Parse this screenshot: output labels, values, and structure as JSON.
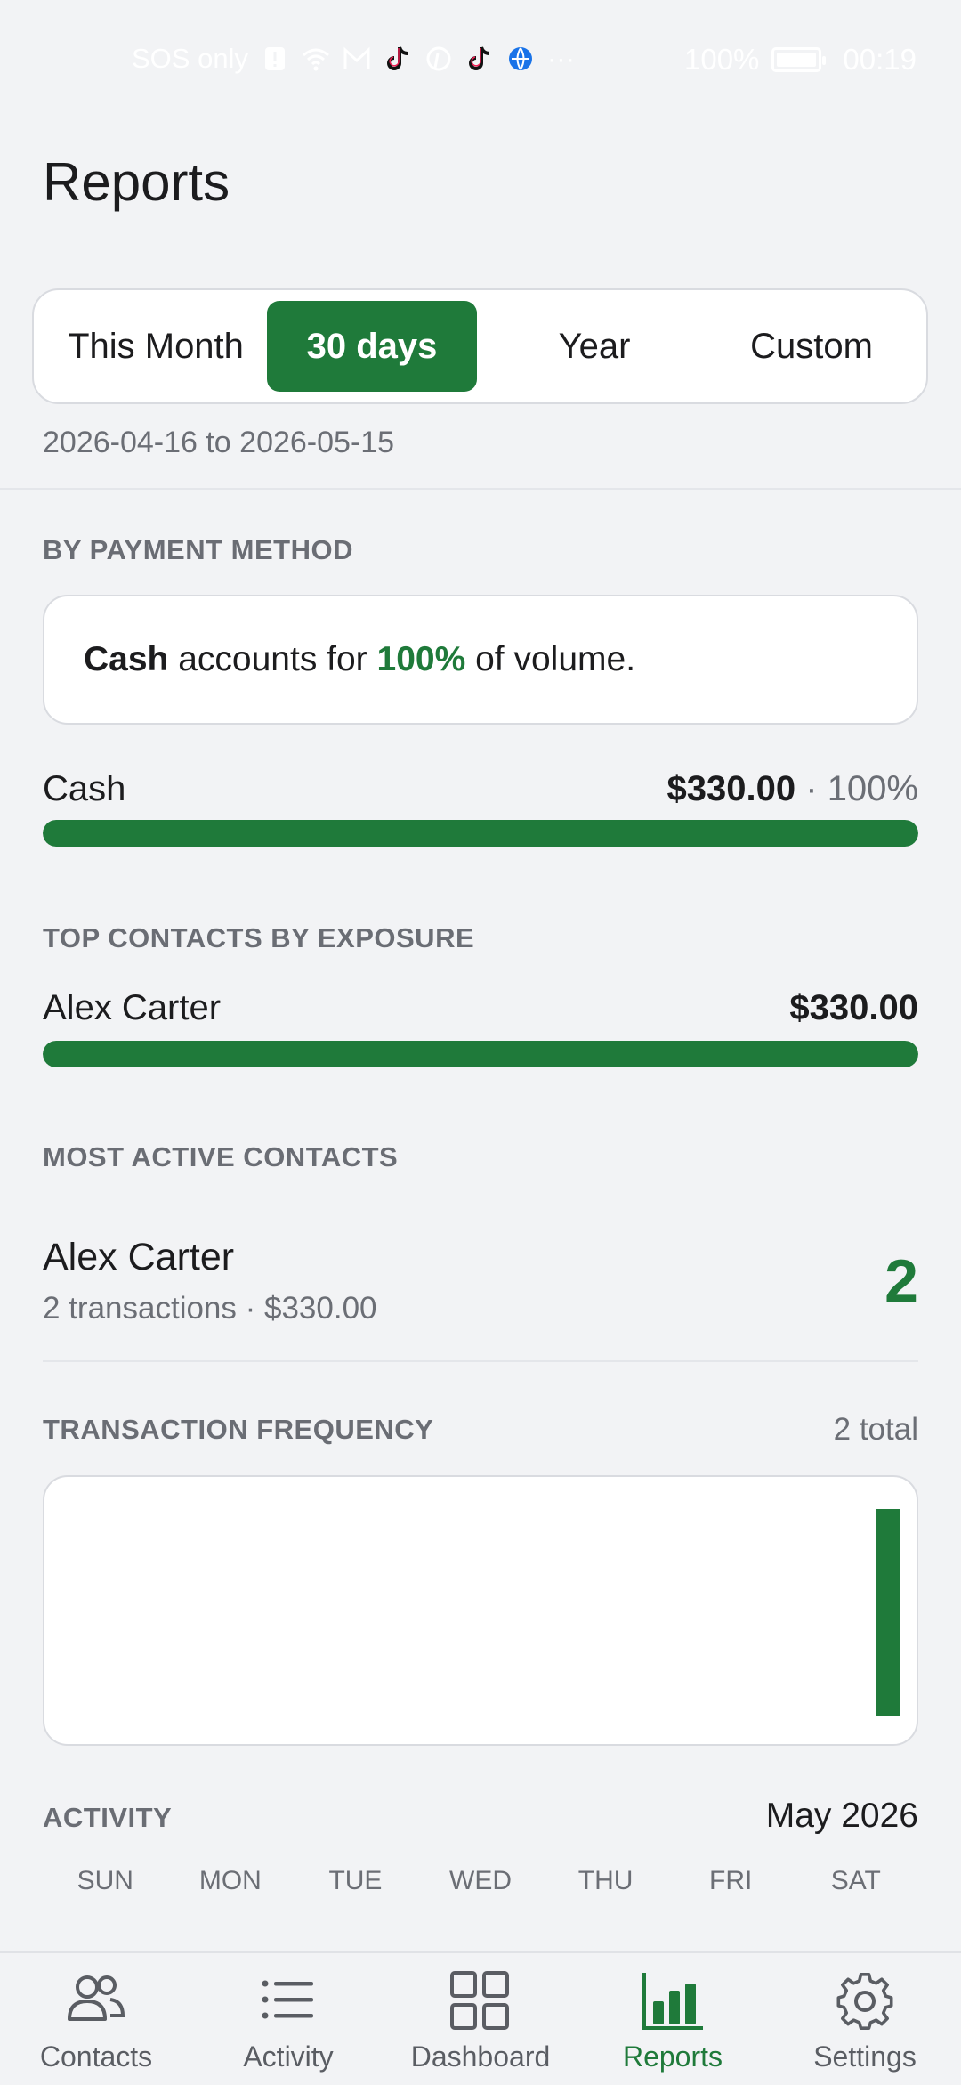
{
  "status_bar": {
    "carrier": "SOS only",
    "battery": "100%",
    "time": "00:19",
    "more": "···"
  },
  "header": {
    "title": "Reports"
  },
  "range_tabs": {
    "this_month": "This Month",
    "days30": "30 days",
    "year": "Year",
    "custom": "Custom",
    "active": "30 days"
  },
  "date_range": "2026-04-16 to 2026-05-15",
  "payment": {
    "section": "BY PAYMENT METHOD",
    "callout_method": "Cash",
    "callout_mid": "accounts for",
    "callout_pct": "100%",
    "callout_end": "of volume.",
    "row_label": "Cash",
    "row_amount": "$330.00",
    "row_sep": "·",
    "row_pct": "100%",
    "fraction": 1.0
  },
  "exposure": {
    "section": "TOP CONTACTS BY EXPOSURE",
    "name": "Alex Carter",
    "amount": "$330.00",
    "fraction": 1.0
  },
  "active_contacts": {
    "section": "MOST ACTIVE CONTACTS",
    "name": "Alex Carter",
    "subtitle": "2 transactions · $330.00",
    "count": "2"
  },
  "frequency": {
    "section": "TRANSACTION FREQUENCY",
    "total": "2 total"
  },
  "chart_data": {
    "type": "bar",
    "title": "TRANSACTION FREQUENCY",
    "categories": [],
    "values": [
      0,
      0,
      0,
      0,
      0,
      0,
      0,
      0,
      0,
      0,
      0,
      0,
      0,
      0,
      0,
      0,
      0,
      0,
      0,
      0,
      0,
      0,
      0,
      0,
      0,
      0,
      0,
      0,
      0,
      2
    ],
    "xlabel": "",
    "ylabel": "",
    "ylim": [
      0,
      2
    ],
    "grid": false
  },
  "activity": {
    "section": "ACTIVITY",
    "month": "May 2026",
    "weekdays": [
      "SUN",
      "MON",
      "TUE",
      "WED",
      "THU",
      "FRI",
      "SAT"
    ]
  },
  "bottom_nav": {
    "items": [
      {
        "label": "Contacts",
        "icon": "contacts-icon"
      },
      {
        "label": "Activity",
        "icon": "list-icon"
      },
      {
        "label": "Dashboard",
        "icon": "grid-icon"
      },
      {
        "label": "Reports",
        "icon": "bar-chart-icon"
      },
      {
        "label": "Settings",
        "icon": "gear-icon"
      }
    ],
    "active": "Reports"
  },
  "colors": {
    "accent": "#1f7a3a",
    "background": "#f2f3f5",
    "card": "#ffffff",
    "muted_text": "#6b6e75"
  }
}
